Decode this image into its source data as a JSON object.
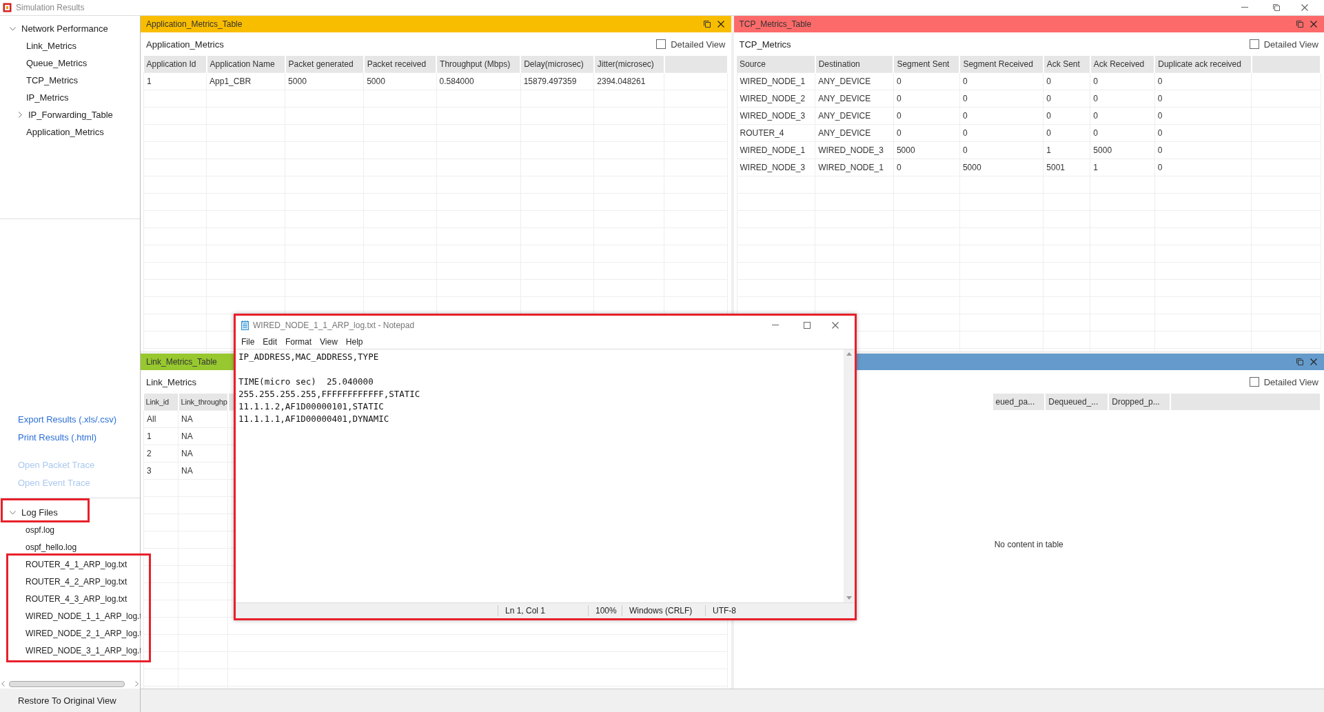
{
  "window": {
    "title": "Simulation Results"
  },
  "sidebar": {
    "tree": [
      {
        "label": "Network Performance",
        "kind": "group",
        "expanded": true,
        "children": [
          {
            "label": "Link_Metrics",
            "kind": "leaf"
          },
          {
            "label": "Queue_Metrics",
            "kind": "leaf"
          },
          {
            "label": "TCP_Metrics",
            "kind": "leaf"
          },
          {
            "label": "IP_Metrics",
            "kind": "leaf"
          },
          {
            "label": "IP_Forwarding_Table",
            "kind": "group",
            "expanded": false
          },
          {
            "label": "Application_Metrics",
            "kind": "leaf"
          }
        ]
      }
    ],
    "actions": [
      {
        "label": "Export Results (.xls/.csv)",
        "disabled": false
      },
      {
        "label": "Print Results (.html)",
        "disabled": false
      },
      {
        "label": "Open Packet Trace",
        "disabled": true
      },
      {
        "label": "Open Event Trace",
        "disabled": true
      }
    ],
    "log_files": {
      "label": "Log Files",
      "expanded": true,
      "files": [
        "ospf.log",
        "ospf_hello.log",
        "ROUTER_4_1_ARP_log.txt",
        "ROUTER_4_2_ARP_log.txt",
        "ROUTER_4_3_ARP_log.txt",
        "WIRED_NODE_1_1_ARP_log.t",
        "WIRED_NODE_2_1_ARP_log.t",
        "WIRED_NODE_3_1_ARP_log.t"
      ]
    },
    "restore_button": "Restore To Original View"
  },
  "panels": [
    {
      "title": "Application_Metrics_Table",
      "color": "#f9bd00",
      "heading": "Application_Metrics",
      "detailed_view": {
        "label": "Detailed View",
        "checked": false
      },
      "columns": [
        "Application Id",
        "Application Name",
        "Packet generated",
        "Packet received",
        "Throughput (Mbps)",
        "Delay(microsec)",
        "Jitter(microsec)"
      ],
      "rows": [
        [
          "1",
          "App1_CBR",
          "5000",
          "5000",
          "0.584000",
          "15879.497359",
          "2394.048261"
        ]
      ]
    },
    {
      "title": "TCP_Metrics_Table",
      "color": "#fd6a6a",
      "heading": "TCP_Metrics",
      "detailed_view": {
        "label": "Detailed View",
        "checked": false
      },
      "columns": [
        "Source",
        "Destination",
        "Segment Sent",
        "Segment Received",
        "Ack Sent",
        "Ack Received",
        "Duplicate ack received"
      ],
      "rows": [
        [
          "WIRED_NODE_1",
          "ANY_DEVICE",
          "0",
          "0",
          "0",
          "0",
          "0"
        ],
        [
          "WIRED_NODE_2",
          "ANY_DEVICE",
          "0",
          "0",
          "0",
          "0",
          "0"
        ],
        [
          "WIRED_NODE_3",
          "ANY_DEVICE",
          "0",
          "0",
          "0",
          "0",
          "0"
        ],
        [
          "ROUTER_4",
          "ANY_DEVICE",
          "0",
          "0",
          "0",
          "0",
          "0"
        ],
        [
          "WIRED_NODE_1",
          "WIRED_NODE_3",
          "5000",
          "0",
          "1",
          "5000",
          "0"
        ],
        [
          "WIRED_NODE_3",
          "WIRED_NODE_1",
          "0",
          "5000",
          "5001",
          "1",
          "0"
        ]
      ]
    },
    {
      "title": "Link_Metrics_Table",
      "color": "#97c82f",
      "heading": "Link_Metrics",
      "columns": [
        "Link_id",
        "Link_throughp"
      ],
      "rows": [
        [
          "All",
          "NA"
        ],
        [
          "1",
          "NA"
        ],
        [
          "2",
          "NA"
        ],
        [
          "3",
          "NA"
        ]
      ]
    },
    {
      "color": "#649bcc",
      "detailed_view": {
        "label": "Detailed View",
        "checked": false
      },
      "columns": [
        "eued_pa...",
        "Dequeued_...",
        "Dropped_p..."
      ],
      "empty_message": "No content in table"
    }
  ],
  "notepad": {
    "title": "WIRED_NODE_1_1_ARP_log.txt - Notepad",
    "menu": [
      "File",
      "Edit",
      "Format",
      "View",
      "Help"
    ],
    "content": "IP_ADDRESS,MAC_ADDRESS,TYPE\n\nTIME(micro sec)  25.040000\n255.255.255.255,FFFFFFFFFFFF,STATIC\n11.1.1.2,AF1D00000101,STATIC\n11.1.1.1,AF1D00000401,DYNAMIC",
    "status": [
      "Ln 1, Col 1",
      "100%",
      "Windows (CRLF)",
      "UTF-8"
    ]
  }
}
